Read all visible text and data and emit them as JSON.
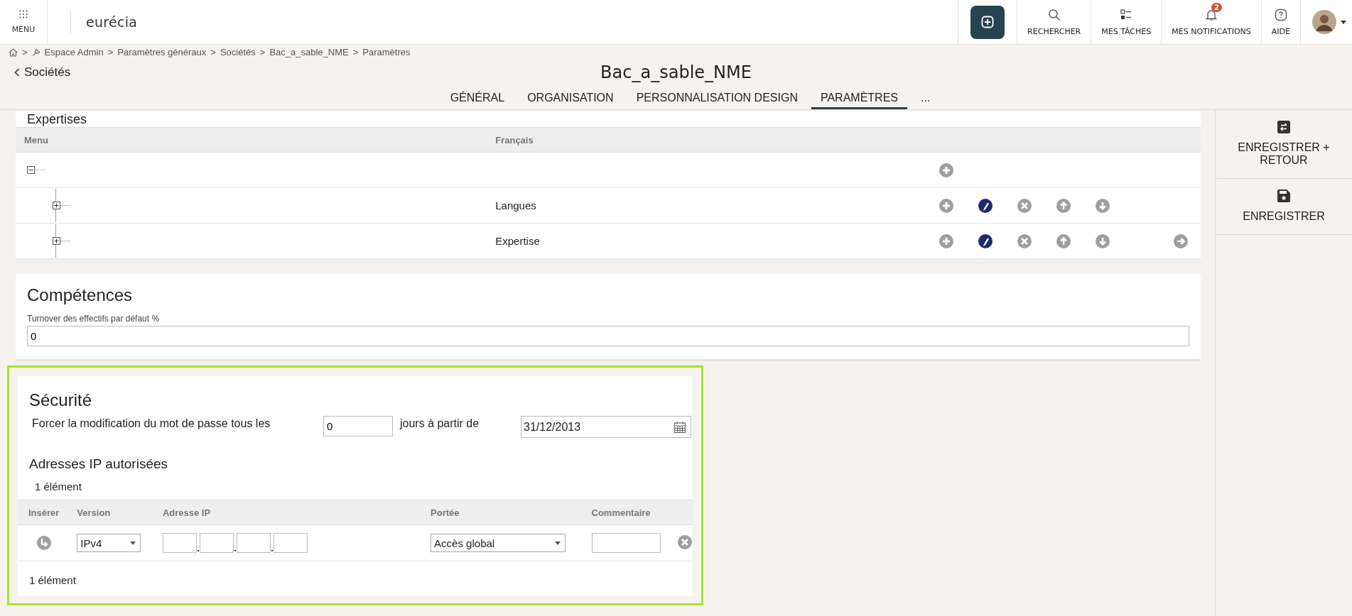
{
  "header": {
    "menu_label": "MENU",
    "logo": "eurécia",
    "actions": [
      {
        "kind": "search",
        "label": "RECHERCHER"
      },
      {
        "kind": "tasks",
        "label": "MES TÂCHES"
      },
      {
        "kind": "notifications",
        "label": "MES NOTIFICATIONS",
        "badge": "2"
      },
      {
        "kind": "help",
        "label": "AIDE"
      }
    ]
  },
  "breadcrumb": [
    {
      "separator": ">",
      "label": "Espace Admin"
    },
    {
      "separator": ">",
      "label": "Paramètres généraux"
    },
    {
      "separator": ">",
      "label": "Sociétés"
    },
    {
      "separator": ">",
      "label": "Bac_a_sable_NME"
    },
    {
      "separator": ">",
      "label": "Paramètres"
    }
  ],
  "back_link": "Sociétés",
  "page_title": "Bac_a_sable_NME",
  "tabs": [
    {
      "label": "GÉNÉRAL",
      "selected": false
    },
    {
      "label": "ORGANISATION",
      "selected": false
    },
    {
      "label": "PERSONNALISATION DESIGN",
      "selected": false
    },
    {
      "label": "PARAMÈTRES",
      "selected": true
    },
    {
      "label": "...",
      "selected": false
    }
  ],
  "sidebar": [
    {
      "kind": "save_return",
      "label": "ENREGISTRER + RETOUR"
    },
    {
      "kind": "save",
      "label": "ENREGISTRER"
    }
  ],
  "expertises": {
    "title": "Expertises",
    "columns": [
      "Menu",
      "Français"
    ],
    "tree": [
      {
        "expanded": true,
        "can_add": true,
        "can_edit": false,
        "can_delete": false,
        "can_move_up": false,
        "can_move_down": false,
        "can_open": false,
        "children": [
          {
            "label": "Langues",
            "expanded": false,
            "can_add": true,
            "can_edit": true,
            "can_delete": true,
            "can_move_up": true,
            "can_move_down": true,
            "can_open": false
          },
          {
            "label": "Expertise",
            "expanded": false,
            "can_add": true,
            "can_edit": true,
            "can_delete": true,
            "can_move_up": true,
            "can_move_down": true,
            "can_open": true
          }
        ]
      }
    ]
  },
  "competences": {
    "title": "Compétences",
    "field_label": "Turnover des effectifs par défaut %",
    "value": "0"
  },
  "securite": {
    "title": "Sécurité",
    "highlighted": true,
    "password_rule": {
      "prefix": "Forcer la modification du mot de passe tous les",
      "days": "0",
      "middle": "jours à partir de",
      "date": "31/12/2013"
    },
    "ip": {
      "title": "Adresses IP autorisées",
      "count": "1 élément",
      "columns": [
        "Insérer",
        "Version",
        "Adresse IP",
        "Portée",
        "Commentaire"
      ],
      "rows": [
        {
          "version": "IPv4",
          "scope": "Accès global"
        }
      ],
      "footer_count": "1 élément"
    }
  }
}
